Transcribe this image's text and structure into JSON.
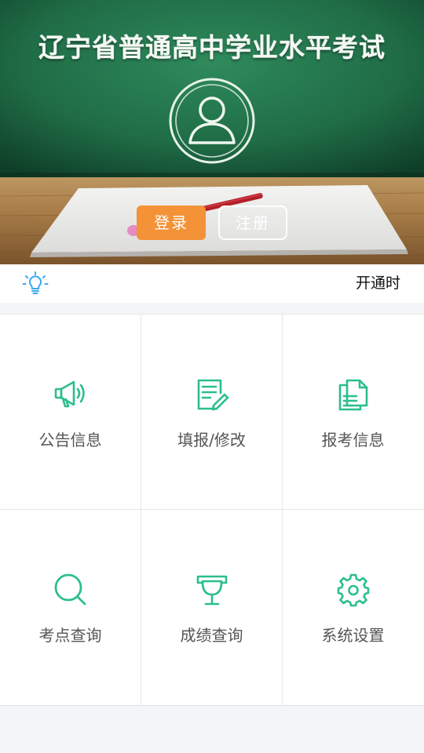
{
  "hero": {
    "title": "辽宁省普通高中学业水平考试",
    "login_label": "登录",
    "register_label": "注册"
  },
  "notice": {
    "text": "开通时"
  },
  "menu": [
    {
      "label": "公告信息",
      "icon": "megaphone-icon"
    },
    {
      "label": "填报/修改",
      "icon": "edit-form-icon"
    },
    {
      "label": "报考信息",
      "icon": "documents-icon"
    },
    {
      "label": "考点查询",
      "icon": "search-icon"
    },
    {
      "label": "成绩查询",
      "icon": "trophy-icon"
    },
    {
      "label": "系统设置",
      "icon": "gear-icon"
    }
  ],
  "colors": {
    "accent_green": "#2bbf8a",
    "login_orange": "#f39236",
    "notice_icon_blue": "#3aa8f0"
  }
}
